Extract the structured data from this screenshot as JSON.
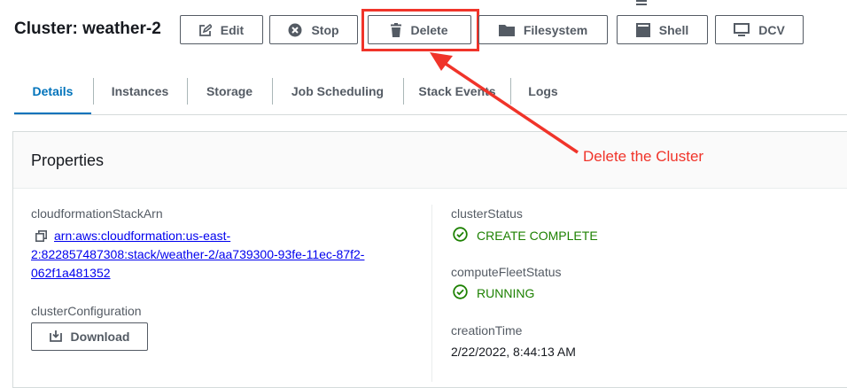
{
  "cluster": {
    "title": "Cluster: weather-2"
  },
  "toolbar": {
    "edit_label": "Edit",
    "stop_label": "Stop",
    "delete_label": "Delete",
    "filesystem_label": "Filesystem",
    "shell_label": "Shell",
    "dcv_label": "DCV"
  },
  "tabs": [
    {
      "label": "Details",
      "active": true
    },
    {
      "label": "Instances",
      "active": false
    },
    {
      "label": "Storage",
      "active": false
    },
    {
      "label": "Job Scheduling",
      "active": false
    },
    {
      "label": "Stack Events",
      "active": false
    },
    {
      "label": "Logs",
      "active": false
    }
  ],
  "properties": {
    "title": "Properties",
    "stack_arn_label": "cloudformationStackArn",
    "stack_arn_line1": "arn:aws:cloudformation:us-east-",
    "stack_arn_line2": "2:822857487308:stack/weather-2/aa739300-93fe-11ec-87f2-",
    "stack_arn_line3": "062f1a481352",
    "cluster_config_label": "clusterConfiguration",
    "download_label": "Download",
    "cluster_status_label": "clusterStatus",
    "cluster_status_value": "CREATE COMPLETE",
    "compute_fleet_label": "computeFleetStatus",
    "compute_fleet_value": "RUNNING",
    "creation_time_label": "creationTime",
    "creation_time_value": "2/22/2022, 8:44:13 AM"
  },
  "annotation": {
    "text": "Delete the Cluster"
  },
  "colors": {
    "highlight": "#f0342a",
    "accent": "#0073bb",
    "success": "#1d8102",
    "link": "#0000ee"
  }
}
